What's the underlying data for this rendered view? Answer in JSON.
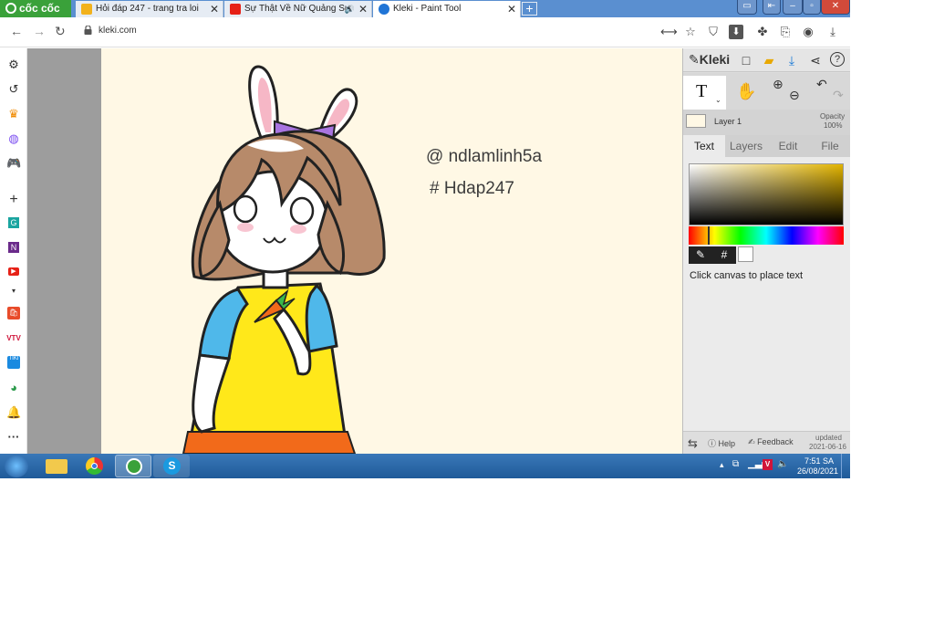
{
  "browser": {
    "brand": "cốc cốc",
    "tabs": [
      {
        "title": "Hỏi đáp 247 - trang tra loi",
        "active": false
      },
      {
        "title": "Sự Thật Về Nữ Quảng Sư",
        "active": false
      },
      {
        "title": "Kleki - Paint Tool",
        "active": true
      }
    ],
    "new_tab": "+",
    "url": "kleki.com"
  },
  "canvas": {
    "texts": [
      "@ ndlamlinh5a",
      "# Hdap247"
    ]
  },
  "panel": {
    "logo": "Kleki",
    "layer_name": "Layer 1",
    "opacity_label": "Opacity",
    "opacity_value": "100%",
    "tabs": [
      "Text",
      "Layers",
      "Edit",
      "File"
    ],
    "active_tab": "Text",
    "hash": "#",
    "hint": "Click canvas to place text",
    "footer": {
      "help": "Help",
      "feedback": "Feedback",
      "updated_label": "updated",
      "updated_date": "2021-06-16"
    }
  },
  "taskbar": {
    "time": "7:51 SA",
    "date": "26/08/2021"
  },
  "colors": {
    "canvas_bg": "#fff8e5",
    "dress": "#ffe81a",
    "sleeve": "#4fb8ea",
    "hair": "#b78a6a",
    "bow": "#a874e0"
  }
}
